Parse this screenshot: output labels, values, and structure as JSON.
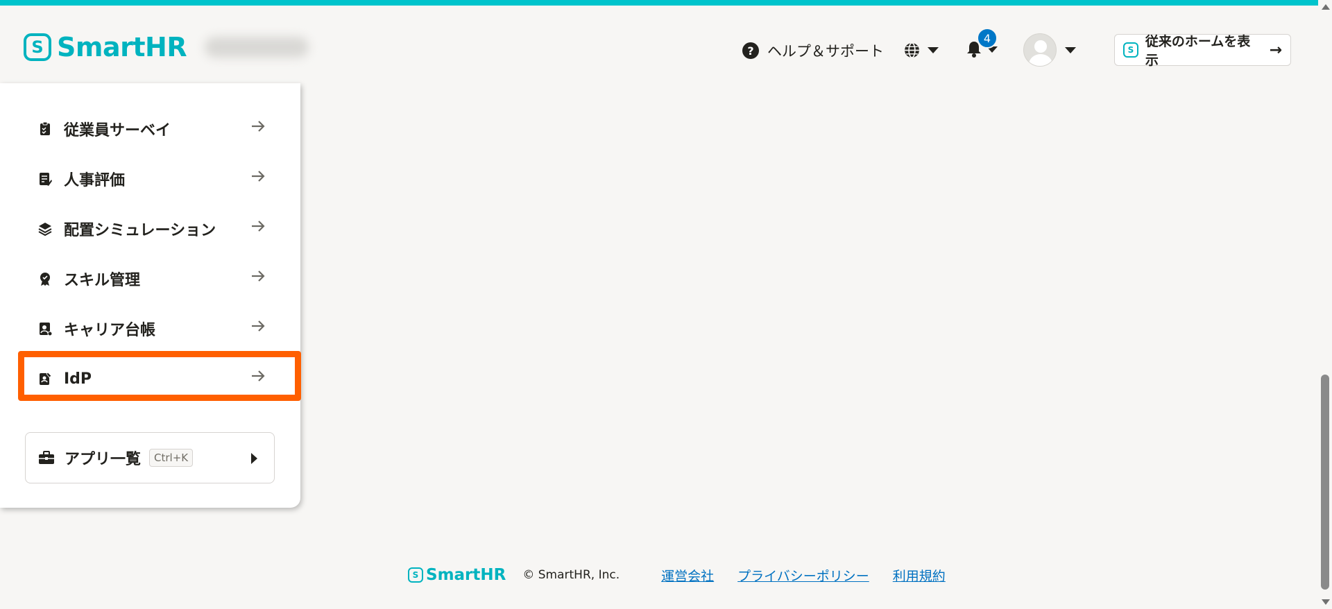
{
  "header": {
    "logo_text": "SmartHR",
    "logo_mark": "S",
    "help_label": "ヘルプ＆サポート",
    "notification_count": "4",
    "home_button_label": "従来のホームを表示",
    "home_button_arrow": "→"
  },
  "menu": {
    "items": [
      {
        "label": "従業員サーベイ",
        "icon": "survey-icon"
      },
      {
        "label": "人事評価",
        "icon": "evaluation-icon"
      },
      {
        "label": "配置シミュレーション",
        "icon": "placement-icon"
      },
      {
        "label": "スキル管理",
        "icon": "skill-icon"
      },
      {
        "label": "キャリア台帳",
        "icon": "career-icon"
      },
      {
        "label": "IdP",
        "icon": "idp-icon"
      }
    ],
    "highlighted_item": "IdP",
    "highlight_color": "#ff5f00",
    "apps_label": "アプリ一覧",
    "apps_shortcut": "Ctrl+K"
  },
  "footer": {
    "logo_text": "SmartHR",
    "copyright": "© SmartHR, Inc.",
    "links": [
      "運営会社",
      "プライバシーポリシー",
      "利用規約"
    ]
  },
  "colors": {
    "brand": "#00c4cc",
    "badge": "#0077c7",
    "link": "#0071c1"
  }
}
